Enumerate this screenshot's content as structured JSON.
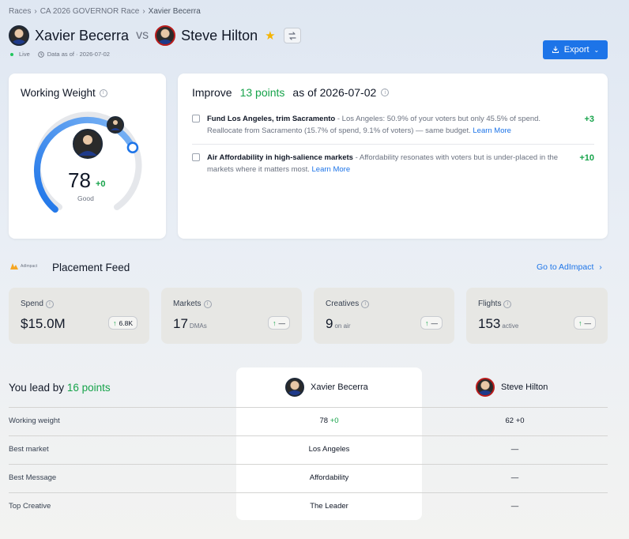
{
  "breadcrumb": [
    "Races",
    "CA 2026 GOVERNOR Race",
    "Xavier Becerra"
  ],
  "header": {
    "candidate_a": "Xavier Becerra",
    "vs": "vs",
    "candidate_b": "Steve Hilton",
    "live": "Live",
    "data_as_of": "Data as of · 2026-07-02",
    "export_label": "Export"
  },
  "working_weight": {
    "title": "Working Weight",
    "score": "78",
    "delta": "+0",
    "label": "Good",
    "level_fraction": 0.78
  },
  "improve": {
    "prefix": "Improve",
    "points": "13 points",
    "suffix": "as of 2026-07-02",
    "items": [
      {
        "title": "Fund Los Angeles, trim Sacramento",
        "desc": " - Los Angeles: 50.9% of your voters but only 45.5% of spend. Reallocate from Sacramento (15.7% of spend, 9.1% of voters) — same budget. ",
        "link": "Learn More",
        "gain": "+3"
      },
      {
        "title": "Air Affordability in high-salience markets",
        "desc": " - Affordability resonates with voters but is under-placed in the markets where it matters most. ",
        "link": "Learn More",
        "gain": "+10"
      }
    ]
  },
  "feed": {
    "logo_text": "AdImpact",
    "title": "Placement Feed",
    "goto": "Go to AdImpact"
  },
  "stats": [
    {
      "label": "Spend",
      "value": "$15.0M",
      "unit": "",
      "trend": "6.8K"
    },
    {
      "label": "Markets",
      "value": "17",
      "unit": "DMAs",
      "trend": "—"
    },
    {
      "label": "Creatives",
      "value": "9",
      "unit": "on air",
      "trend": "—"
    },
    {
      "label": "Flights",
      "value": "153",
      "unit": "active",
      "trend": "—"
    }
  ],
  "comparison": {
    "lead_prefix": "You lead by",
    "lead_points": "16 points",
    "col_a": "Xavier Becerra",
    "col_b": "Steve Hilton",
    "rows": [
      {
        "label": "Working weight",
        "a": "78",
        "a_delta": "+0",
        "b": "62",
        "b_delta": "+0"
      },
      {
        "label": "Best market",
        "a": "Los Angeles",
        "b": "—"
      },
      {
        "label": "Best Message",
        "a": "Affordability",
        "b": "—"
      },
      {
        "label": "Top Creative",
        "a": "The Leader",
        "b": "—"
      }
    ]
  },
  "colors": {
    "accent": "#1d74e8",
    "positive": "#16a34a",
    "star": "#f5b400"
  }
}
